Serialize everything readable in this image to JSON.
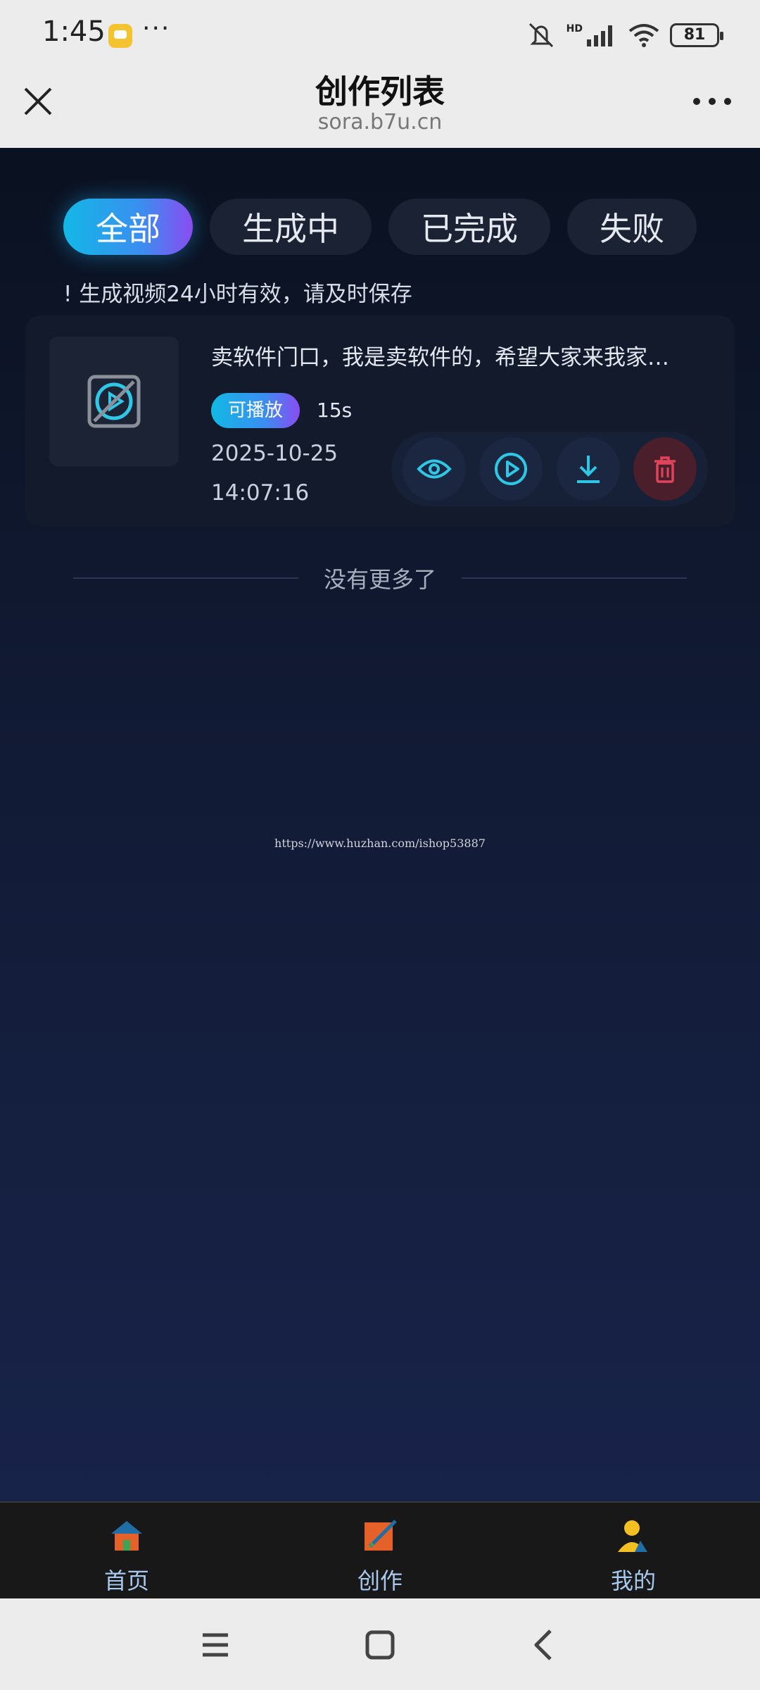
{
  "status_bar": {
    "time": "1:45",
    "more": "···",
    "network_label": "HD",
    "battery": "81",
    "icons": [
      "notification-app-icon",
      "mute-icon",
      "signal-icon",
      "wifi-icon",
      "battery-icon"
    ]
  },
  "header": {
    "title": "创作列表",
    "domain": "sora.b7u.cn",
    "icons": [
      "close-icon",
      "more-icon"
    ]
  },
  "tabs": [
    {
      "label": "全部",
      "active": true
    },
    {
      "label": "生成中",
      "active": false
    },
    {
      "label": "已完成",
      "active": false
    },
    {
      "label": "失败",
      "active": false
    }
  ],
  "notice": "! 生成视频24小时有效，请及时保存",
  "items": [
    {
      "title": "卖软件门口，我是卖软件的，希望大家来我家…",
      "badge": "可播放",
      "duration": "15s",
      "date": "2025-10-25",
      "time": "14:07:16",
      "actions": [
        "view-icon",
        "play-icon",
        "download-icon",
        "delete-icon"
      ]
    }
  ],
  "no_more": "没有更多了",
  "watermark": "https://www.huzhan.com/ishop53887",
  "bottom_nav": [
    {
      "label": "首页",
      "icon": "home-icon"
    },
    {
      "label": "创作",
      "icon": "create-icon"
    },
    {
      "label": "我的",
      "icon": "profile-icon"
    }
  ],
  "system_nav": [
    "menu-icon",
    "home-square-icon",
    "back-icon"
  ],
  "colors": {
    "accent_start": "#12b8e6",
    "accent_end": "#8a4cf2",
    "icon_cyan": "#2ec8e6",
    "danger": "#e0445a",
    "background_top": "#0a1120",
    "background_bottom": "#18234a"
  }
}
